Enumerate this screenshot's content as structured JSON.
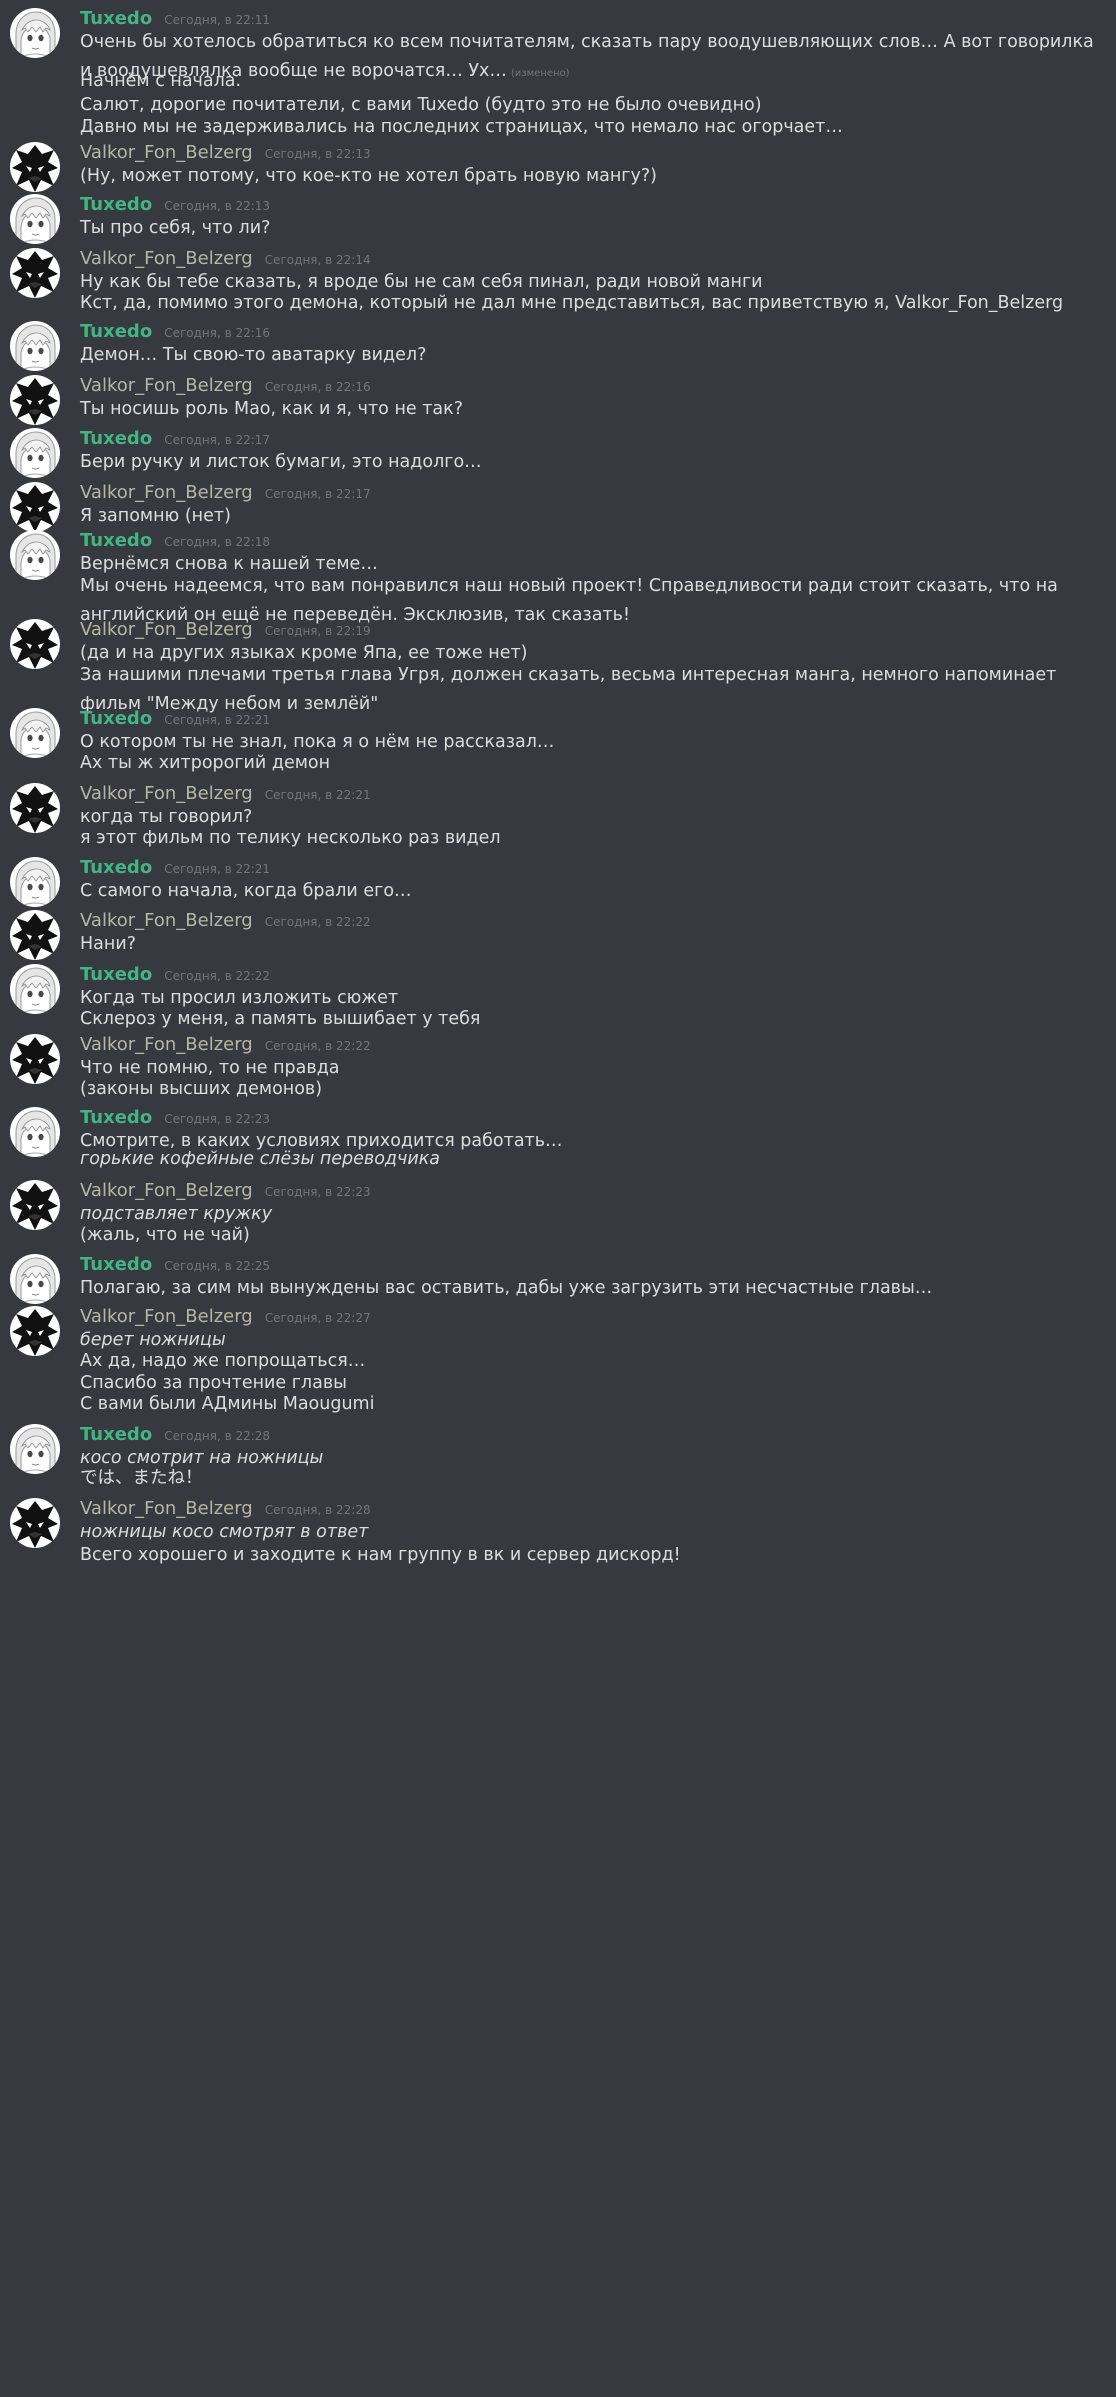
{
  "users": {
    "tuxedo": {
      "name": "Tuxedo",
      "color": "#43b581",
      "avatar_icon": "white-haired-girl-avatar-icon"
    },
    "valkor": {
      "name": "Valkor_Fon_Belzerg",
      "color": "#b8b7a2",
      "avatar_icon": "dark-demon-avatar-icon"
    }
  },
  "messages": [
    {
      "user": "tuxedo",
      "name": "Tuxedo",
      "time": "Сегодня, в 22:11",
      "lines": [
        {
          "text": "Очень бы хотелось обратиться ко всем почитателям, сказать пару воодушевляющих слов… А вот говорилка и воодушевлялка вообще не ворочатся… Ух…",
          "edited": "(изменено)"
        },
        {
          "text": "Начнём с начала."
        },
        {
          "text": "Салют, дорогие почитатели, с вами Tuxedo (будто это не было очевидно)"
        },
        {
          "text": "Давно мы не задерживались на последних страницах, что немало нас огорчает…"
        }
      ]
    },
    {
      "user": "valkor",
      "name": "Valkor_Fon_Belzerg",
      "time": "Сегодня, в 22:13",
      "lines": [
        {
          "text": "(Ну, может потому, что кое-кто не хотел брать новую мангу?)"
        }
      ]
    },
    {
      "user": "tuxedo",
      "name": "Tuxedo",
      "time": "Сегодня, в 22:13",
      "lines": [
        {
          "text": "Ты про себя, что ли?"
        }
      ]
    },
    {
      "user": "valkor",
      "name": "Valkor_Fon_Belzerg",
      "time": "Сегодня, в 22:14",
      "lines": [
        {
          "text": "Ну как бы тебе сказать, я вроде бы не сам себя пинал, ради новой манги"
        },
        {
          "text": "Кст, да, помимо этого демона, который не дал мне представиться, вас приветствую я, Valkor_Fon_Belzerg"
        }
      ]
    },
    {
      "user": "tuxedo",
      "name": "Tuxedo",
      "time": "Сегодня, в 22:16",
      "lines": [
        {
          "text": "Демон… Ты свою-то аватарку видел?"
        }
      ]
    },
    {
      "user": "valkor",
      "name": "Valkor_Fon_Belzerg",
      "time": "Сегодня, в 22:16",
      "lines": [
        {
          "text": "Ты носишь роль Мао, как и я, что не так?"
        }
      ]
    },
    {
      "user": "tuxedo",
      "name": "Tuxedo",
      "time": "Сегодня, в 22:17",
      "lines": [
        {
          "text": "Бери ручку и листок бумаги, это надолго…"
        }
      ]
    },
    {
      "user": "valkor",
      "name": "Valkor_Fon_Belzerg",
      "time": "Сегодня, в 22:17",
      "lines": [
        {
          "text": "Я запомню (нет)"
        }
      ]
    },
    {
      "user": "tuxedo",
      "name": "Tuxedo",
      "time": "Сегодня, в 22:18",
      "lines": [
        {
          "text": "Вернёмся снова к нашей теме…"
        },
        {
          "text": "Мы очень надеемся, что вам понравился наш новый проект! Справедливости ради стоит сказать, что на английский он ещё не переведён. Эксклюзив, так сказать!"
        }
      ]
    },
    {
      "user": "valkor",
      "name": "Valkor_Fon_Belzerg",
      "time": "Сегодня, в 22:19",
      "lines": [
        {
          "text": "(да и на других языках кроме Япа, ее тоже нет)"
        },
        {
          "text": "За нашими плечами третья глава Угря, должен сказать, весьма интересная манга, немного напоминает фильм \"Между небом и землёй\""
        }
      ]
    },
    {
      "user": "tuxedo",
      "name": "Tuxedo",
      "time": "Сегодня, в 22:21",
      "lines": [
        {
          "text": "О котором ты не знал, пока я о нём не рассказал…"
        },
        {
          "text": "Ах ты ж хитророгий демон"
        }
      ]
    },
    {
      "user": "valkor",
      "name": "Valkor_Fon_Belzerg",
      "time": "Сегодня, в 22:21",
      "lines": [
        {
          "text": "когда ты говорил?"
        },
        {
          "text": "я этот фильм по телику несколько раз видел"
        }
      ]
    },
    {
      "user": "tuxedo",
      "name": "Tuxedo",
      "time": "Сегодня, в 22:21",
      "lines": [
        {
          "text": "С самого начала, когда брали его…"
        }
      ]
    },
    {
      "user": "valkor",
      "name": "Valkor_Fon_Belzerg",
      "time": "Сегодня, в 22:22",
      "lines": [
        {
          "text": "Нани?"
        }
      ]
    },
    {
      "user": "tuxedo",
      "name": "Tuxedo",
      "time": "Сегодня, в 22:22",
      "lines": [
        {
          "text": "Когда ты просил изложить сюжет"
        },
        {
          "text": "Склероз у меня, а память вышибает у тебя"
        }
      ]
    },
    {
      "user": "valkor",
      "name": "Valkor_Fon_Belzerg",
      "time": "Сегодня, в 22:22",
      "lines": [
        {
          "text": "Что не помню, то не правда"
        },
        {
          "text": "(законы высших демонов)"
        }
      ]
    },
    {
      "user": "tuxedo",
      "name": "Tuxedo",
      "time": "Сегодня, в 22:23",
      "lines": [
        {
          "text": "Смотрите, в каких условиях приходится работать…"
        },
        {
          "text": "горькие кофейные слёзы переводчика",
          "italic": true
        }
      ]
    },
    {
      "user": "valkor",
      "name": "Valkor_Fon_Belzerg",
      "time": "Сегодня, в 22:23",
      "lines": [
        {
          "text": "подставляет кружку",
          "italic": true
        },
        {
          "text": "(жаль, что не чай)"
        }
      ]
    },
    {
      "user": "tuxedo",
      "name": "Tuxedo",
      "time": "Сегодня, в 22:25",
      "lines": [
        {
          "text": "Полагаю, за сим мы вынуждены вас оставить, дабы уже загрузить эти несчастные главы…"
        }
      ]
    },
    {
      "user": "valkor",
      "name": "Valkor_Fon_Belzerg",
      "time": "Сегодня, в 22:27",
      "lines": [
        {
          "text": "берет ножницы",
          "italic": true
        },
        {
          "text": "Ах да, надо же попрощаться…"
        },
        {
          "text": "Спасибо за прочтение главы"
        },
        {
          "text": "С вами были АДмины Maougumi"
        }
      ]
    },
    {
      "user": "tuxedo",
      "name": "Tuxedo",
      "time": "Сегодня, в 22:28",
      "lines": [
        {
          "text": "косо смотрит на ножницы",
          "italic": true
        },
        {
          "text": "では、またね！"
        }
      ]
    },
    {
      "user": "valkor",
      "name": "Valkor_Fon_Belzerg",
      "time": "Сегодня, в 22:28",
      "lines": [
        {
          "text": "ножницы косо смотрят в ответ",
          "italic": true
        },
        {
          "text": "Всего хорошего и заходите к нам группу в вк и сервер дискорд!"
        }
      ]
    }
  ]
}
